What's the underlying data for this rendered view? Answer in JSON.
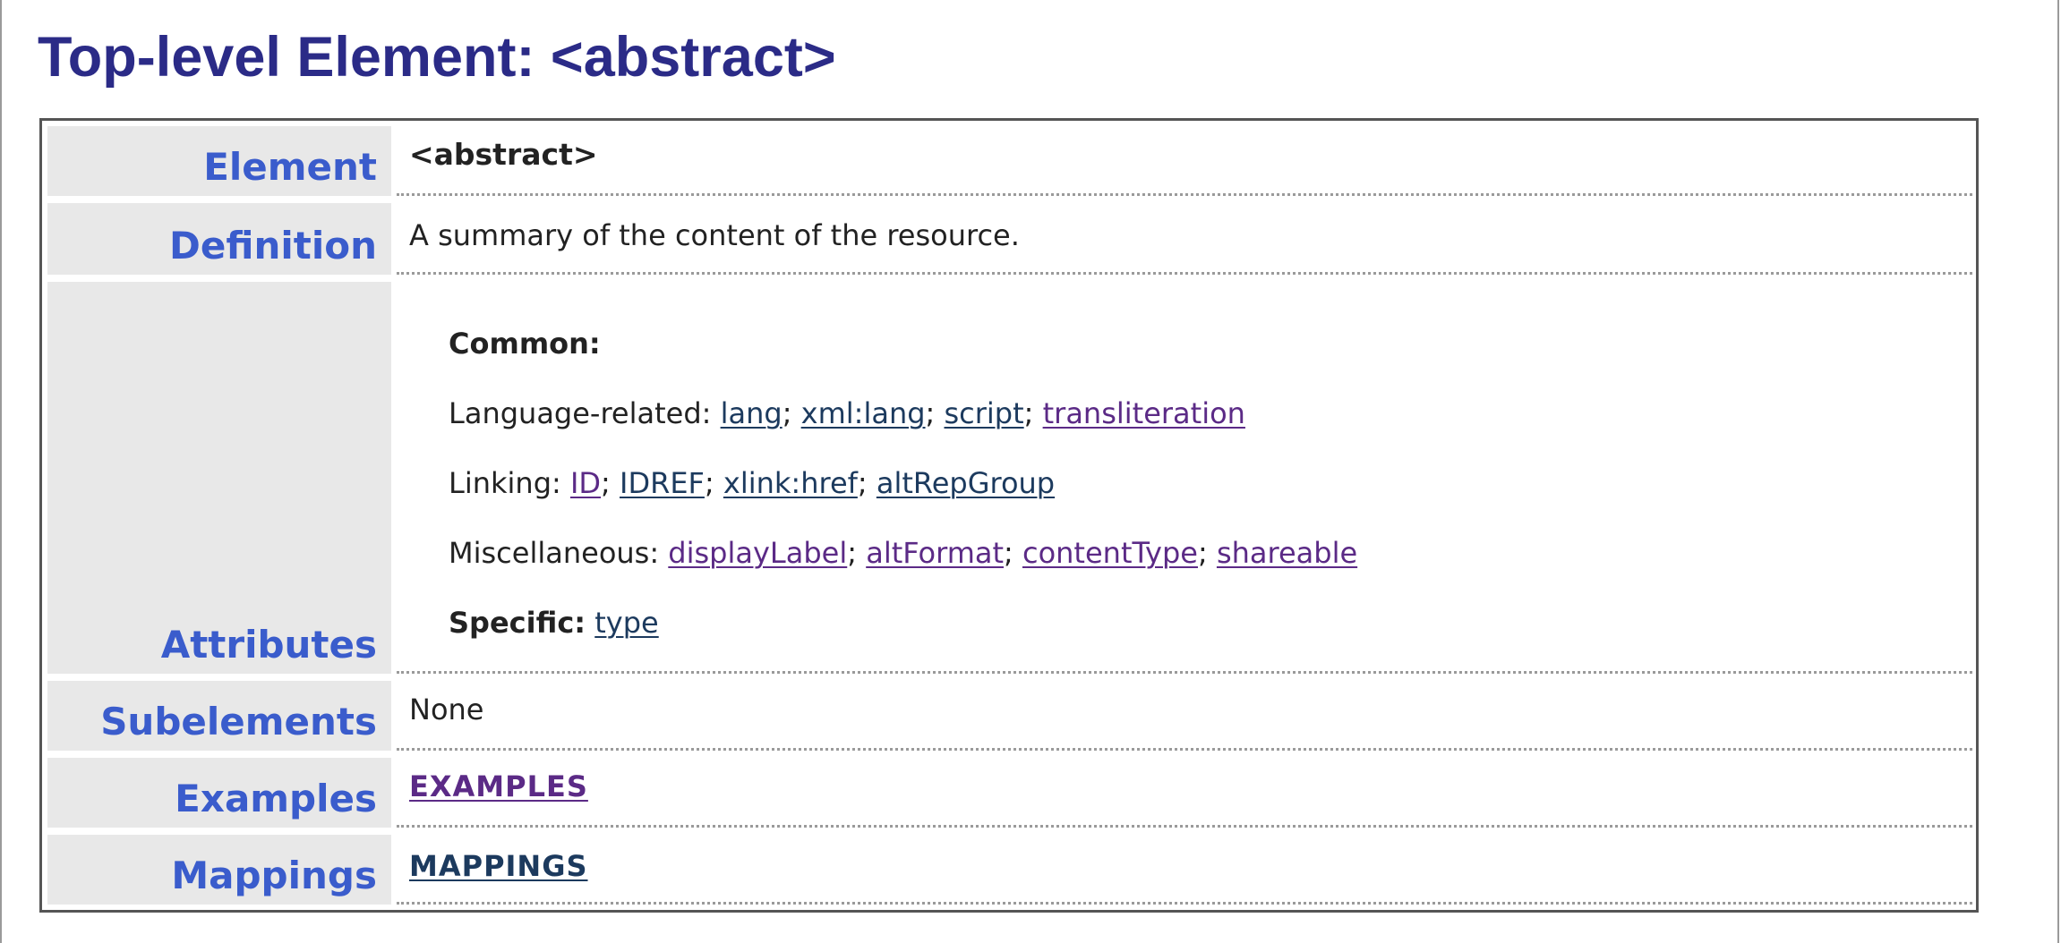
{
  "page": {
    "title": "Top-level Element: <abstract>"
  },
  "table": {
    "element": {
      "label": "Element",
      "value": "<abstract>"
    },
    "definition": {
      "label": "Definition",
      "value": "A summary of the content of the resource."
    },
    "attributes": {
      "label": "Attributes",
      "common_heading": "Common:",
      "language_prefix": "Language-related: ",
      "language_links": [
        "lang",
        "xml:lang",
        "script",
        "transliteration"
      ],
      "linking_prefix": "Linking: ",
      "linking_links": [
        "ID",
        "IDREF",
        "xlink:href",
        "altRepGroup"
      ],
      "misc_prefix": "Miscellaneous: ",
      "misc_links": [
        "displayLabel",
        "altFormat",
        "contentType",
        "shareable"
      ],
      "specific_heading": "Specific:",
      "specific_links": [
        "type"
      ]
    },
    "subelements": {
      "label": "Subelements",
      "value": "None"
    },
    "examples": {
      "label": "Examples",
      "link": "EXAMPLES"
    },
    "mappings": {
      "label": "Mappings",
      "link": "MAPPINGS"
    }
  },
  "colors": {
    "title": "#2b2b87",
    "label": "#3a5ccc",
    "label_background": "#e8e8e8",
    "link": "#1c3a5e",
    "link_visited": "#5b2a86"
  }
}
